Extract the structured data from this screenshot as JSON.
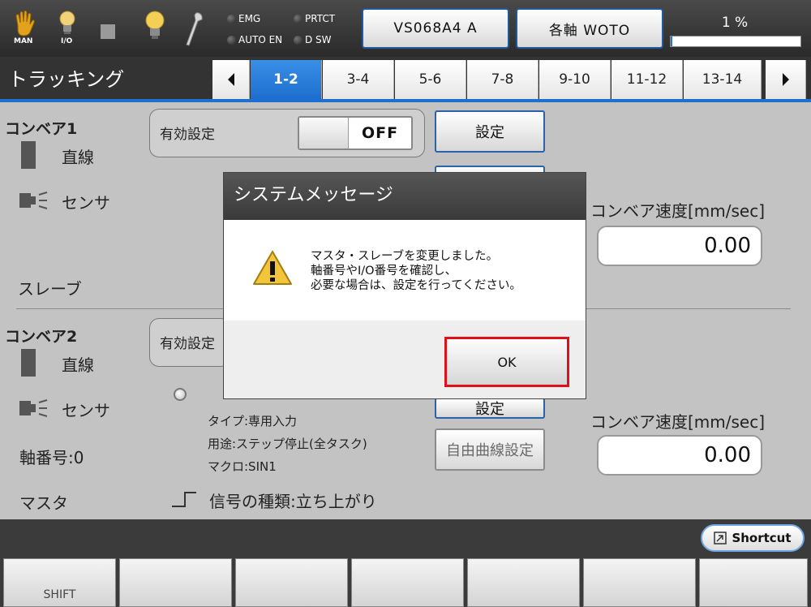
{
  "topbar": {
    "man_label": "MAN",
    "io_label": "I/O",
    "leds": [
      {
        "label": "EMG"
      },
      {
        "label": "PRTCT"
      },
      {
        "label": "AUTO EN"
      },
      {
        "label": "D SW"
      }
    ],
    "robot_button": "VS068A4 A",
    "mode_button": "各軸 WOTO",
    "speed_percent": "1 %",
    "speed_fraction": 0.01
  },
  "screen": {
    "title": "トラッキング",
    "tabs": [
      "1-2",
      "3-4",
      "5-6",
      "7-8",
      "9-10",
      "11-12",
      "13-14"
    ],
    "active_tab": "1-2"
  },
  "conveyor1": {
    "name": "コンベア1",
    "type": "直線",
    "sensor": "センサ",
    "enable_label": "有効設定",
    "toggle": "OFF",
    "settings_button": "設定",
    "speed_label": "コンベア速度[mm/sec]",
    "speed_value": "0.00",
    "role": "スレーブ"
  },
  "conveyor2": {
    "name": "コンベア2",
    "type": "直線",
    "sensor": "センサ",
    "enable_label": "有効設定",
    "input_type": "タイプ:専用入力",
    "input_use": "用途:ステップ停止(全タスク)",
    "input_macro": "マクロ:SIN1",
    "signal_type": "信号の種類:立ち上がり",
    "axis_number": "軸番号:0",
    "role": "マスタ",
    "settings_button": "設定",
    "curve_button": "自由曲線設定",
    "speed_label": "コンベア速度[mm/sec]",
    "speed_value": "0.00"
  },
  "dialog": {
    "title": "システムメッセージ",
    "lines": [
      "マスタ・スレーブを変更しました。",
      "軸番号やI/O番号を確認し、",
      "必要な場合は、設定を行ってください。"
    ],
    "ok": "OK"
  },
  "bottom": {
    "shortcut": "Shortcut",
    "fkeys": [
      "SHIFT",
      "",
      "",
      "",
      "",
      "",
      ""
    ]
  }
}
